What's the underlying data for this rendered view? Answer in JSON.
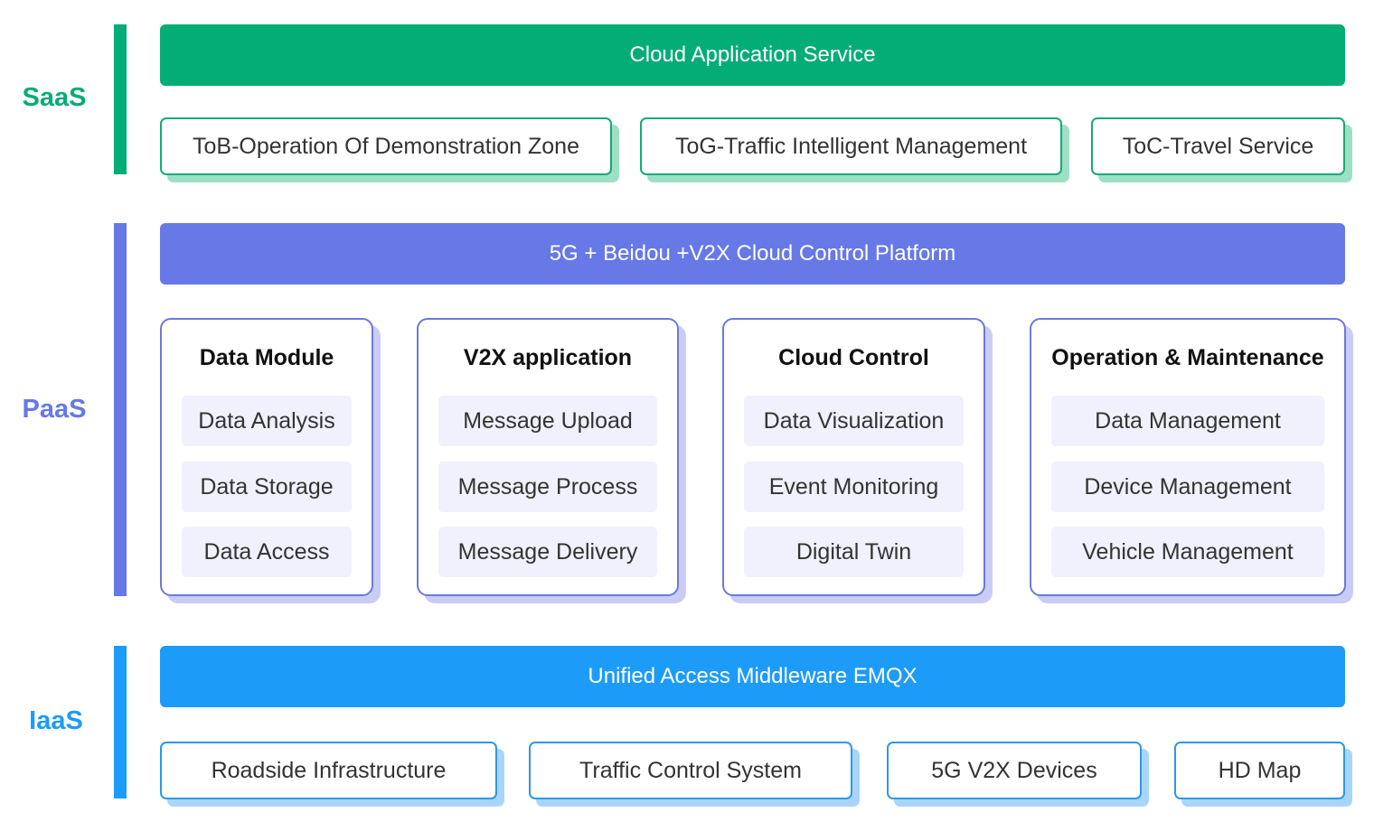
{
  "colors": {
    "saas": "#04ad76",
    "paas": "#6779e6",
    "iaas": "#1d9bf9"
  },
  "saas": {
    "label": "SaaS",
    "banner": "Cloud Application Service",
    "items": [
      "ToB-Operation Of Demonstration Zone",
      "ToG-Traffic Intelligent Management",
      "ToC-Travel Service"
    ]
  },
  "paas": {
    "label": "PaaS",
    "banner": "5G + Beidou +V2X Cloud Control Platform",
    "modules": [
      {
        "title": "Data Module",
        "items": [
          "Data Analysis",
          "Data Storage",
          "Data Access"
        ]
      },
      {
        "title": "V2X application",
        "items": [
          "Message Upload",
          "Message Process",
          "Message Delivery"
        ]
      },
      {
        "title": "Cloud Control",
        "items": [
          "Data Visualization",
          "Event Monitoring",
          "Digital Twin"
        ]
      },
      {
        "title": "Operation & Maintenance",
        "items": [
          "Data Management",
          "Device Management",
          "Vehicle Management"
        ]
      }
    ]
  },
  "iaas": {
    "label": "IaaS",
    "banner": "Unified Access Middleware EMQX",
    "items": [
      "Roadside Infrastructure",
      "Traffic Control System",
      "5G V2X Devices",
      "HD Map"
    ]
  }
}
